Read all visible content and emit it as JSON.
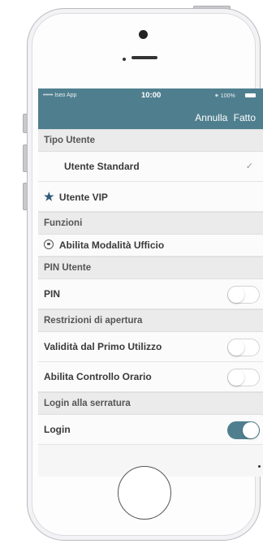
{
  "status": {
    "carrier": "••••• Iseo App",
    "time": "10:00",
    "battery": "⁕ 100%"
  },
  "nav": {
    "cancel": "Annulla",
    "done": "Fatto"
  },
  "sections": {
    "user_type": "Tipo Utente",
    "functions": "Funzioni",
    "pin_user": "PIN Utente",
    "restrictions": "Restrizioni di apertura",
    "login_lock": "Login alla serratura"
  },
  "rows": {
    "standard_user": "Utente Standard",
    "standard_check": "✓",
    "vip_user": "Utente VIP",
    "office_mode": "Abilita Modalità Ufficio",
    "pin": "PIN",
    "first_use": "Validità dal Primo Utilizzo",
    "time_control": "Abilita Controllo Orario",
    "login": "Login"
  },
  "toggles": {
    "pin": false,
    "first_use": false,
    "time_control": false,
    "login": true
  },
  "colors": {
    "accent": "#4f7f8f",
    "star": "#2f5a78"
  },
  "icons": [
    "star-icon",
    "lock-icon",
    "checkmark-icon",
    "battery-icon"
  ]
}
